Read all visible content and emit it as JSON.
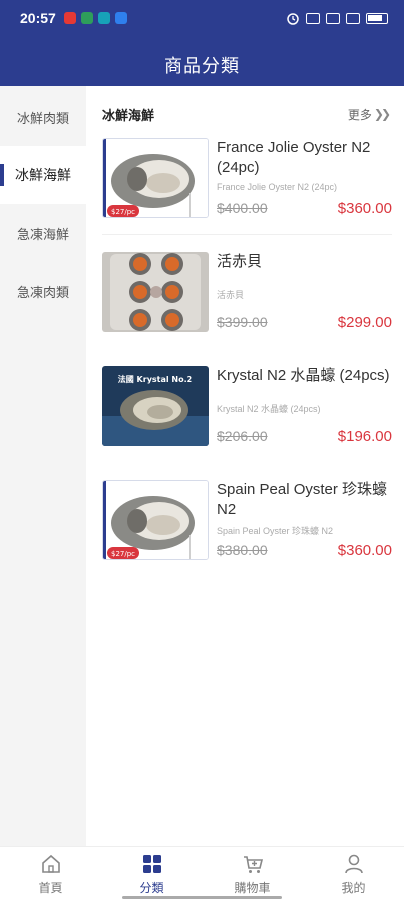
{
  "status_bar": {
    "time": "20:57",
    "app_icons": [
      "red-app-icon",
      "green-app-icon",
      "teal-app-icon",
      "blue-app-icon"
    ],
    "right_icons": [
      "alarm-icon",
      "vibrate-icon",
      "signal-icon",
      "wifi-icon",
      "battery-icon"
    ]
  },
  "header": {
    "title": "商品分類"
  },
  "sidebar": {
    "items": [
      {
        "label": "冰鮮肉類",
        "active": false
      },
      {
        "label": "冰鮮海鮮",
        "active": true
      },
      {
        "label": "急凍海鮮",
        "active": false
      },
      {
        "label": "急凍肉類",
        "active": false
      }
    ]
  },
  "section": {
    "title": "冰鮮海鮮",
    "more_label": "更多",
    "more_icon": "double-chevron-right-icon"
  },
  "products": [
    {
      "name": "France Jolie Oyster N2 (24pc)",
      "subtitle": "France Jolie Oyster N2 (24pc)",
      "old_price": "$400.00",
      "price": "$360.00",
      "image": "oyster-photo",
      "badge": "$27/pc"
    },
    {
      "name": "活赤貝",
      "subtitle": "活赤貝",
      "old_price": "$399.00",
      "price": "$299.00",
      "image": "ark-shell-tray-photo"
    },
    {
      "name": "Krystal N2 水晶蠔 (24pcs)",
      "subtitle": "Krystal N2 水晶蠔 (24pcs)",
      "old_price": "$206.00",
      "price": "$196.00",
      "image": "krystal-oyster-photo",
      "badge": "法國 Krystal No.2"
    },
    {
      "name": "Spain Peal Oyster 珍珠蠔 N2",
      "subtitle": "Spain Peal Oyster 珍珠蠔 N2",
      "old_price": "$380.00",
      "price": "$360.00",
      "image": "oyster-photo",
      "badge": "$27/pc"
    }
  ],
  "tabbar": {
    "tabs": [
      {
        "label": "首頁",
        "icon": "home-icon",
        "active": false
      },
      {
        "label": "分類",
        "icon": "grid-icon",
        "active": true
      },
      {
        "label": "購物車",
        "icon": "cart-icon",
        "active": false
      },
      {
        "label": "我的",
        "icon": "person-icon",
        "active": false
      }
    ]
  },
  "colors": {
    "brand": "#2c3d8f",
    "price_red": "#d9363e",
    "sidebar_bg": "#f4f4f4"
  }
}
